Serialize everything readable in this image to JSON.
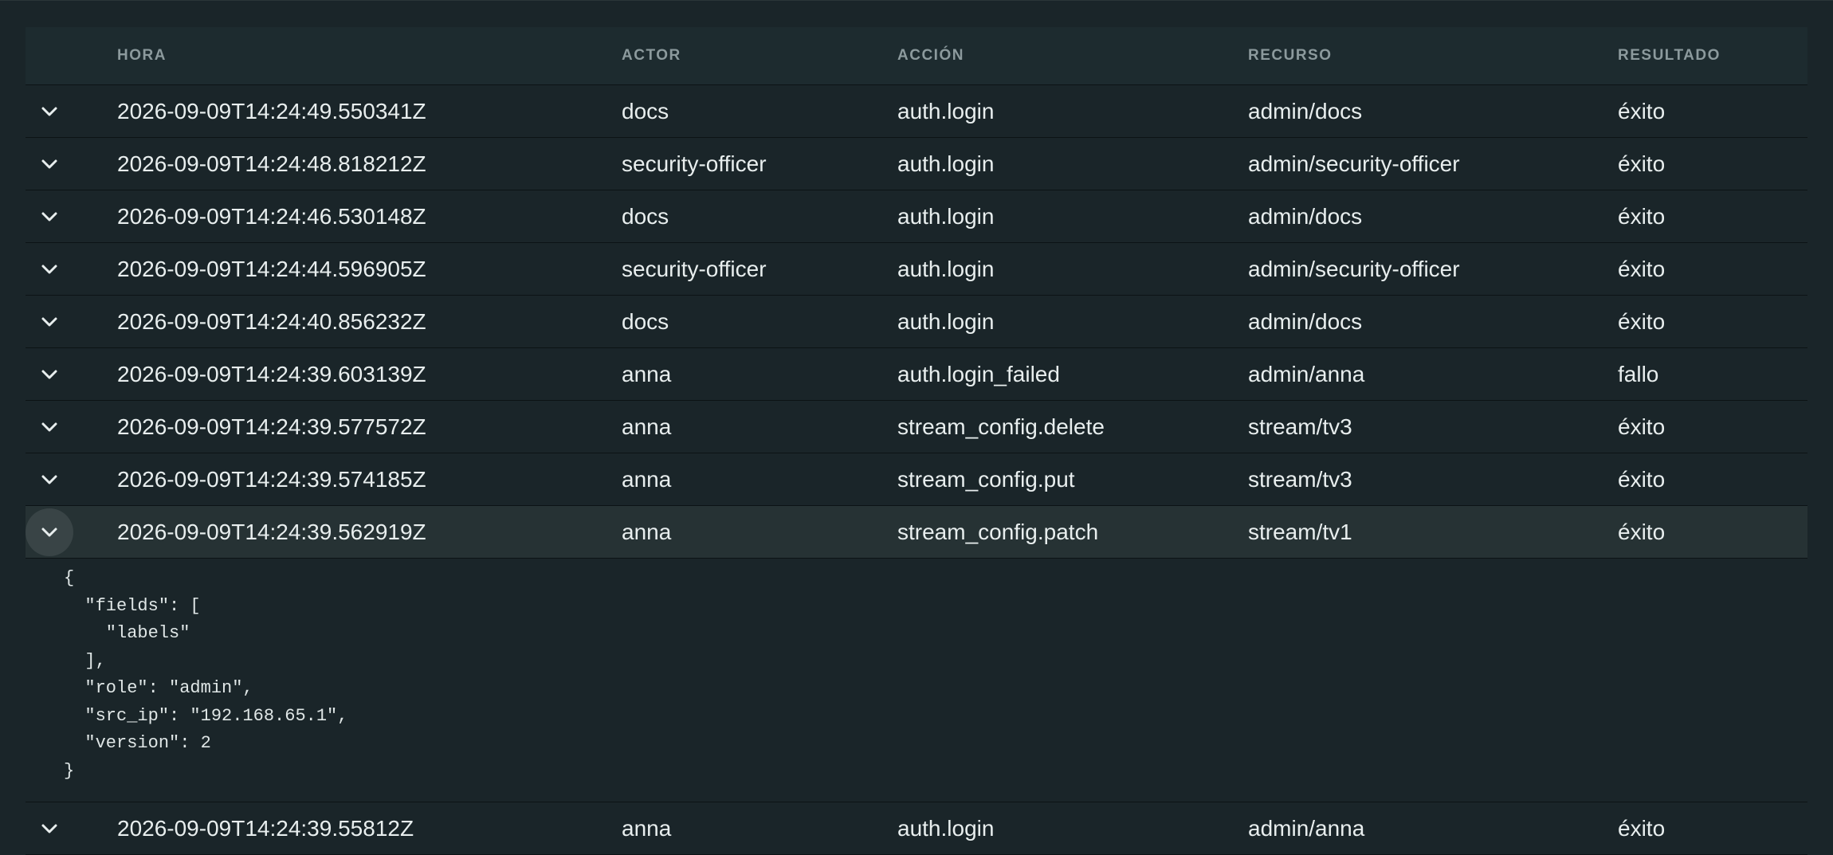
{
  "columns": {
    "time": "HORA",
    "actor": "ACTOR",
    "action": "ACCIÓN",
    "resource": "RECURSO",
    "result": "RESULTADO"
  },
  "rows": [
    {
      "time": "2026-09-09T14:24:49.550341Z",
      "actor": "docs",
      "action": "auth.login",
      "resource": "admin/docs",
      "result": "éxito"
    },
    {
      "time": "2026-09-09T14:24:48.818212Z",
      "actor": "security-officer",
      "action": "auth.login",
      "resource": "admin/security-officer",
      "result": "éxito"
    },
    {
      "time": "2026-09-09T14:24:46.530148Z",
      "actor": "docs",
      "action": "auth.login",
      "resource": "admin/docs",
      "result": "éxito"
    },
    {
      "time": "2026-09-09T14:24:44.596905Z",
      "actor": "security-officer",
      "action": "auth.login",
      "resource": "admin/security-officer",
      "result": "éxito"
    },
    {
      "time": "2026-09-09T14:24:40.856232Z",
      "actor": "docs",
      "action": "auth.login",
      "resource": "admin/docs",
      "result": "éxito"
    },
    {
      "time": "2026-09-09T14:24:39.603139Z",
      "actor": "anna",
      "action": "auth.login_failed",
      "resource": "admin/anna",
      "result": "fallo"
    },
    {
      "time": "2026-09-09T14:24:39.577572Z",
      "actor": "anna",
      "action": "stream_config.delete",
      "resource": "stream/tv3",
      "result": "éxito"
    },
    {
      "time": "2026-09-09T14:24:39.574185Z",
      "actor": "anna",
      "action": "stream_config.put",
      "resource": "stream/tv3",
      "result": "éxito"
    },
    {
      "time": "2026-09-09T14:24:39.562919Z",
      "actor": "anna",
      "action": "stream_config.patch",
      "resource": "stream/tv1",
      "result": "éxito"
    },
    {
      "time": "2026-09-09T14:24:39.55812Z",
      "actor": "anna",
      "action": "auth.login",
      "resource": "admin/anna",
      "result": "éxito"
    }
  ],
  "expanded_detail": "{\n  \"fields\": [\n    \"labels\"\n  ],\n  \"role\": \"admin\",\n  \"src_ip\": \"192.168.65.1\",\n  \"version\": 2\n}",
  "icons": {
    "toggle": "chevron-down-icon"
  }
}
